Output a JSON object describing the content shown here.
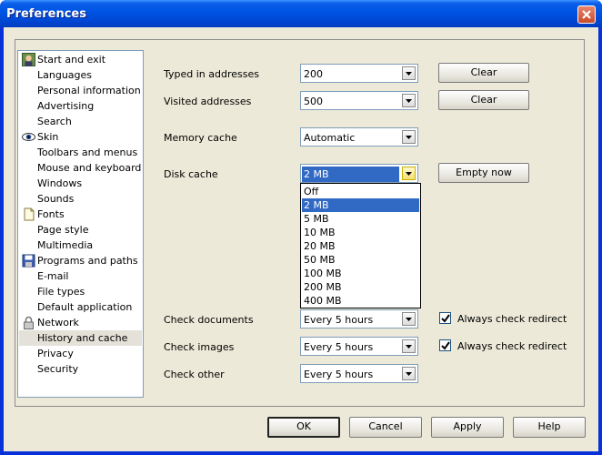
{
  "window": {
    "title": "Preferences"
  },
  "sidebar": {
    "items": [
      {
        "label": "Start and exit",
        "icon": "person-icon"
      },
      {
        "label": "Languages"
      },
      {
        "label": "Personal information"
      },
      {
        "label": "Advertising"
      },
      {
        "label": "Search"
      },
      {
        "label": "Skin",
        "icon": "eye-icon"
      },
      {
        "label": "Toolbars and menus"
      },
      {
        "label": "Mouse and keyboard"
      },
      {
        "label": "Windows"
      },
      {
        "label": "Sounds"
      },
      {
        "label": "Fonts",
        "icon": "document-icon"
      },
      {
        "label": "Page style"
      },
      {
        "label": "Multimedia"
      },
      {
        "label": "Programs and paths",
        "icon": "floppy-icon"
      },
      {
        "label": "E-mail"
      },
      {
        "label": "File types"
      },
      {
        "label": "Default application"
      },
      {
        "label": "Network",
        "icon": "padlock-icon"
      },
      {
        "label": "History and cache",
        "selected": true
      },
      {
        "label": "Privacy"
      },
      {
        "label": "Security"
      }
    ]
  },
  "history": {
    "typed_label": "Typed in addresses",
    "typed_value": "200",
    "typed_clear": "Clear",
    "visited_label": "Visited addresses",
    "visited_value": "500",
    "visited_clear": "Clear",
    "memory_label": "Memory cache",
    "memory_value": "Automatic",
    "disk_label": "Disk cache",
    "disk_value": "2 MB",
    "disk_empty": "Empty now",
    "disk_options": [
      "Off",
      "2 MB",
      "5 MB",
      "10 MB",
      "20 MB",
      "50 MB",
      "100 MB",
      "200 MB",
      "400 MB"
    ],
    "disk_selected_index": 1,
    "check_documents_label": "Check documents",
    "check_documents_value": "Every 5 hours",
    "check_images_label": "Check images",
    "check_images_value": "Every 5 hours",
    "check_other_label": "Check other",
    "check_other_value": "Every 5 hours",
    "redirect_docs_label": "Always check redirect",
    "redirect_docs_checked": true,
    "redirect_images_label": "Always check redirect",
    "redirect_images_checked": true
  },
  "footer": {
    "ok": "OK",
    "cancel": "Cancel",
    "apply": "Apply",
    "help": "Help"
  },
  "colors": {
    "titlebar": "#0055e5",
    "selection": "#316ac5",
    "dialog_bg": "#ece9d8"
  }
}
